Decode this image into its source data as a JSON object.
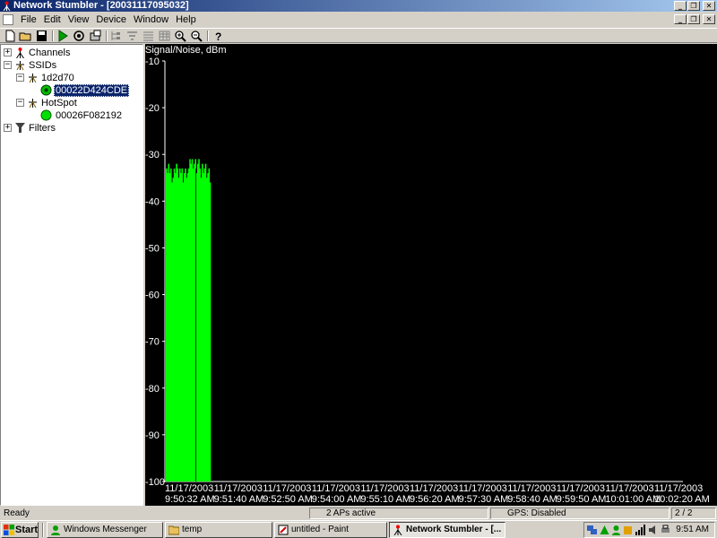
{
  "window": {
    "title": "Network Stumbler - [20031117095032]"
  },
  "menu": {
    "items": [
      "File",
      "Edit",
      "View",
      "Device",
      "Window",
      "Help"
    ]
  },
  "tree": {
    "channels": "Channels",
    "ssids": "SSIDs",
    "network_1": "1d2d70",
    "ap_1": "00022D424CDE",
    "network_2": "HotSpot",
    "ap_2": "00026F082192",
    "filters": "Filters"
  },
  "chart_data": {
    "type": "bar",
    "title": "Signal/Noise, dBm",
    "ylim": [
      -100,
      -10
    ],
    "y_ticks": [
      "-10",
      "-20",
      "-30",
      "-40",
      "-50",
      "-60",
      "-70",
      "-80",
      "-90",
      "-100"
    ],
    "x_ticks": [
      {
        "date": "11/17/2003",
        "time": "9:50:32 AM"
      },
      {
        "date": "11/17/2003",
        "time": "9:51:40 AM"
      },
      {
        "date": "11/17/2003",
        "time": "9:52:50 AM"
      },
      {
        "date": "11/17/2003",
        "time": "9:54:00 AM"
      },
      {
        "date": "11/17/2003",
        "time": "9:55:10 AM"
      },
      {
        "date": "11/17/2003",
        "time": "9:56:20 AM"
      },
      {
        "date": "11/17/2003",
        "time": "9:57:30 AM"
      },
      {
        "date": "11/17/2003",
        "time": "9:58:40 AM"
      },
      {
        "date": "11/17/2003",
        "time": "9:59:50 AM"
      },
      {
        "date": "11/17/2003",
        "time": "10:01:00 AM"
      },
      {
        "date": "11/17/2003",
        "time": "10:02:20 AM"
      }
    ],
    "bar_color": "#00ff00",
    "signal_dbm": [
      -33,
      -34,
      -32,
      -34,
      -33,
      -36,
      -35,
      -33,
      -34,
      -32,
      -33,
      -35,
      -33,
      -34,
      -33,
      -36,
      -34,
      -33,
      -35,
      -34,
      -33,
      -31,
      -32,
      -31,
      -33,
      -32,
      -31,
      -34,
      -32,
      -31,
      -33,
      -35,
      -32,
      -34,
      -33,
      -32,
      -35,
      -34,
      -33,
      -36
    ],
    "noise_dbm": [
      -100,
      -100,
      -100,
      -100,
      -100,
      -100,
      -100,
      -100,
      -100,
      -100,
      -100,
      -100,
      -100,
      -100,
      -100,
      -100,
      -100,
      -100,
      -100,
      -100,
      -100,
      -100,
      -100,
      -100,
      -100,
      -100,
      -100,
      -100,
      -100,
      -100,
      -100,
      -100,
      -100,
      -100,
      -100,
      -100,
      -100,
      -100,
      -100,
      -100
    ]
  },
  "status": {
    "left": "Ready",
    "aps": "2 APs active",
    "gps": "GPS: Disabled",
    "page": "2 / 2"
  },
  "taskbar": {
    "start": "Start",
    "tasks": [
      "Windows Messenger",
      "temp",
      "untitled - Paint",
      "Network Stumbler - [..."
    ],
    "clock": "9:51 AM"
  }
}
